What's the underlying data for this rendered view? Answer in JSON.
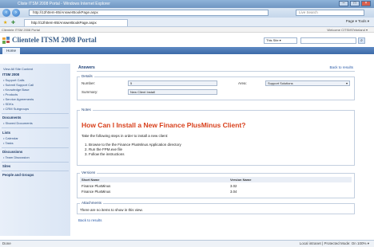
{
  "browser": {
    "title": "Cliste ITSM 2008 Portal - Windows Internet Explorer",
    "url": "http://12h0em-85/AnswerBookPage.aspx",
    "livesearch_placeholder": "Live Search",
    "tab": "http://12h0em-85/AnswerBookPage.aspx",
    "commands": "Page ▾  Tools ▾"
  },
  "sharepoint": {
    "breadcrumb": "Clientele ITSM 2008 Portal",
    "welcome": "Welcome CITSM\\Tebeland ▾",
    "site_title": "Clientele ITSM 2008 Portal",
    "site_selector": "This Site ▾",
    "home_tab": "Home"
  },
  "quicklaunch": {
    "view_all": "View All Site Content",
    "sections": [
      {
        "heading": "ITSM 2008",
        "items": [
          "Support Calls",
          "Submit Support Call",
          "Knowledge Base",
          "Products",
          "Service Agreements",
          "SDKs",
          "CRM Subgroups"
        ]
      },
      {
        "heading": "Documents",
        "items": [
          "Shared Documents"
        ]
      },
      {
        "heading": "Lists",
        "items": [
          "Calendar",
          "Tasks"
        ]
      },
      {
        "heading": "Discussions",
        "items": [
          "Team Discussion"
        ]
      },
      {
        "heading": "Sites",
        "items": []
      },
      {
        "heading": "People and Groups",
        "items": []
      }
    ]
  },
  "main": {
    "heading": "Answers",
    "back_link": "Back to results",
    "details_legend": "Details",
    "number_label": "Number:",
    "number_value": "5",
    "area_label": "Area:",
    "area_value": "Support Solutions",
    "summary_label": "Summary:",
    "summary_value": "New Client Install",
    "notes_legend": "Notes",
    "question": "How Can I Install a New Finance PlusMinus Client?",
    "intro": "Take the following steps in order to install a new client:",
    "steps": [
      "1.   Browse to the the Finance PlusMinus Application directory",
      "2.   Run the FPM.exe file",
      "3.   Follow the instructions"
    ],
    "versions_legend": "Versions",
    "versions_headers": [
      "Short Name",
      "Version Name"
    ],
    "versions_rows": [
      [
        "Finance PlusMinus",
        "3.02"
      ],
      [
        "Finance PlusMinus",
        "3.04"
      ]
    ],
    "attachments_legend": "Attachments",
    "attachments_empty": "There are no items to show in this view.",
    "back_link_bottom": "Back to results"
  },
  "status": {
    "left": "Done",
    "right": "Local intranet | Protected Mode: On    100% ▾"
  }
}
